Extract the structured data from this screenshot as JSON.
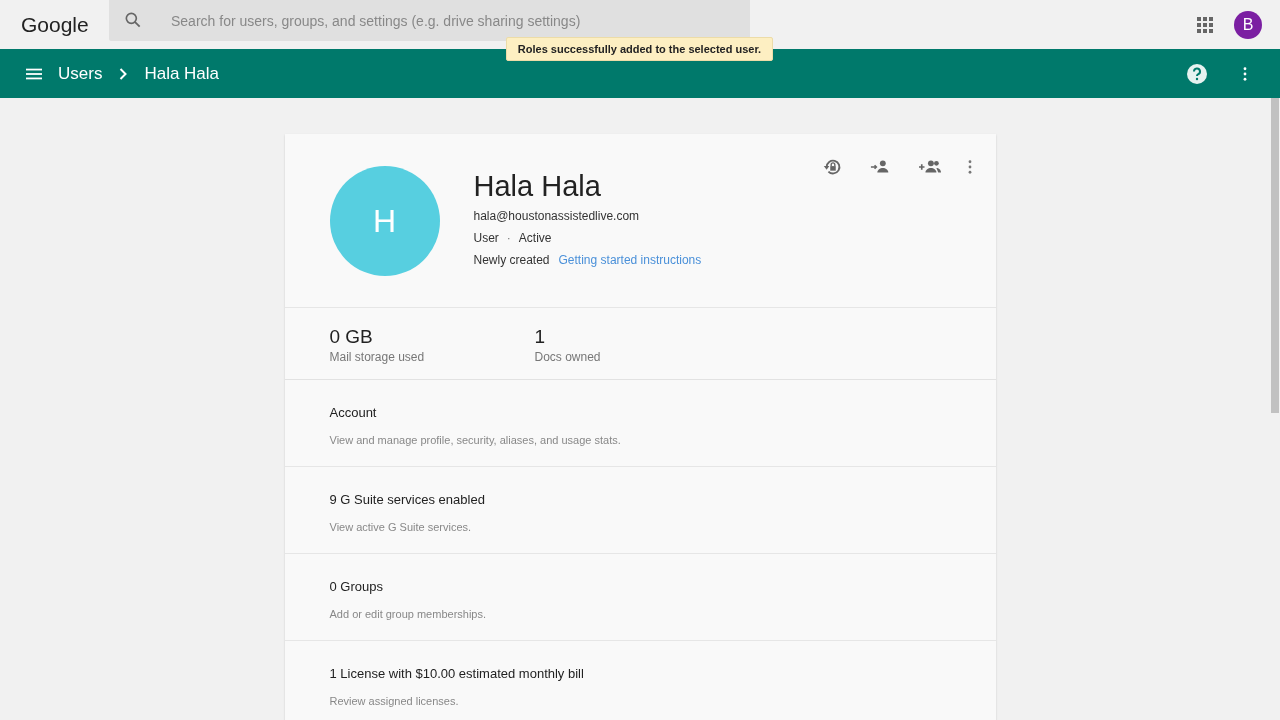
{
  "top_bar": {
    "logo": "Google",
    "search": {
      "placeholder": "Search for users, groups, and settings (e.g. drive sharing settings)"
    },
    "account_initial": "B"
  },
  "toast": "Roles successfully added to the selected user.",
  "breadcrumb": [
    {
      "label": "Users"
    },
    {
      "label": "Hala Hala"
    }
  ],
  "user": {
    "initial": "H",
    "name": "Hala Hala",
    "email": "hala@houstonassistedlive.com",
    "role": "User",
    "separator": "·",
    "status": "Active",
    "created": "Newly created",
    "link": "Getting started instructions"
  },
  "stats": [
    {
      "value": "0 GB",
      "label": "Mail storage used"
    },
    {
      "value": "1",
      "label": "Docs owned"
    }
  ],
  "sections": [
    {
      "title": "Account",
      "description": "View and manage profile, security, aliases, and usage stats."
    },
    {
      "title": "9 G Suite services enabled",
      "description": "View active G Suite services."
    },
    {
      "title": "0 Groups",
      "description": "Add or edit group memberships."
    },
    {
      "title": "1 License with $10.00 estimated monthly bill",
      "description": "Review assigned licenses."
    }
  ]
}
